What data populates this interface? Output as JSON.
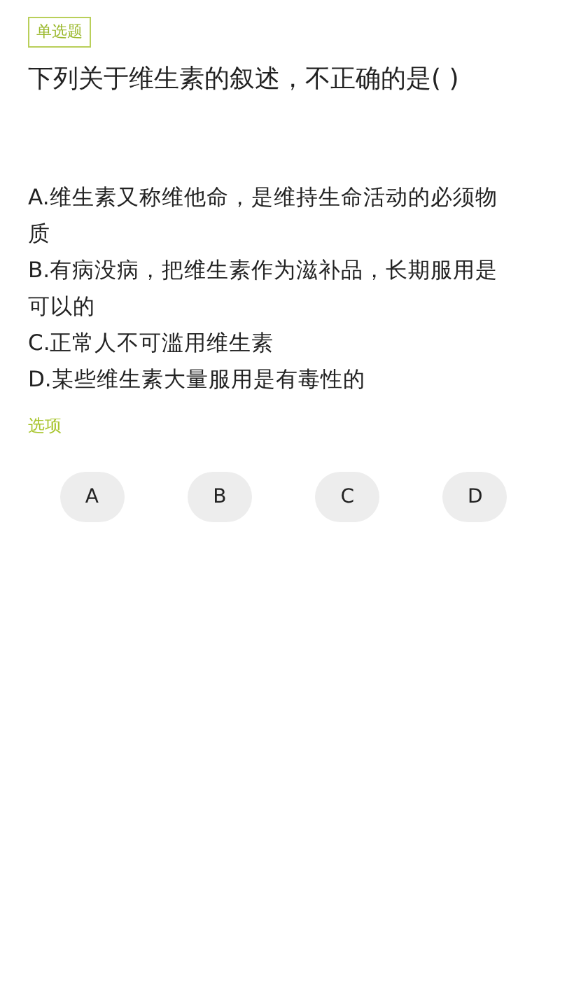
{
  "question_type": "单选题",
  "question": "下列关于维生素的叙述，不正确的是( )",
  "options": [
    "A.维生素又称维他命，是维持生命活动的必须物质",
    "B.有病没病，把维生素作为滋补品，长期服用是可以的",
    "C.正常人不可滥用维生素",
    "D.某些维生素大量服用是有毒性的"
  ],
  "choices_label": "选项",
  "choices": [
    {
      "label": "A",
      "selected": false
    },
    {
      "label": "B",
      "selected": false
    },
    {
      "label": "C",
      "selected": false
    },
    {
      "label": "D",
      "selected": false
    }
  ]
}
